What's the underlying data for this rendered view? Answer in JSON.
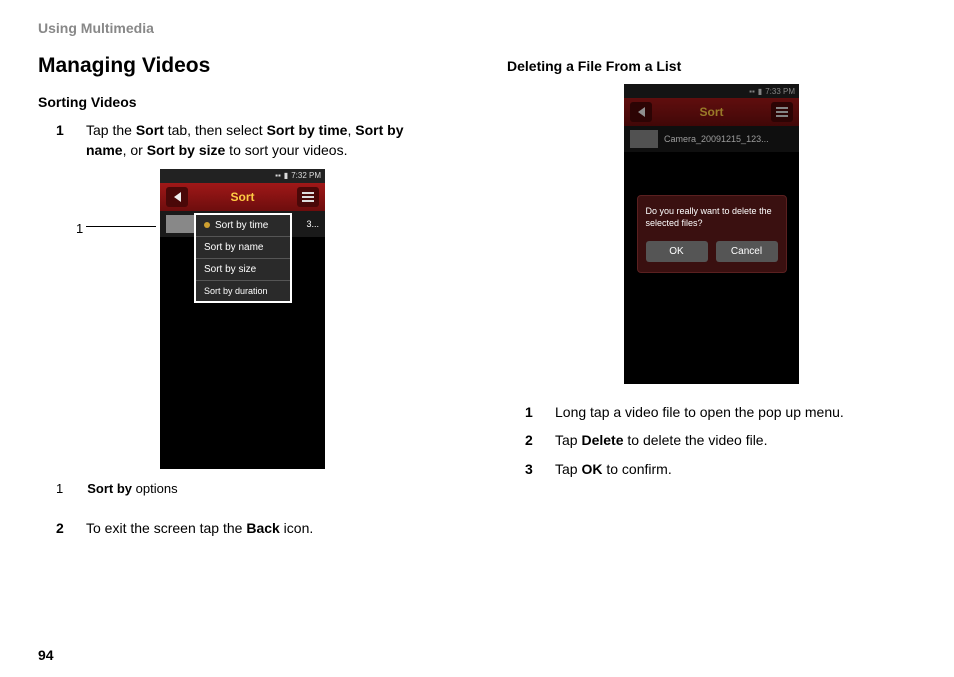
{
  "header": "Using Multimedia",
  "page_number": "94",
  "left": {
    "h1": "Managing Videos",
    "h2": "Sorting Videos",
    "steps": [
      {
        "num": "1",
        "parts": [
          "Tap the ",
          "Sort",
          " tab, then select ",
          "Sort by time",
          ", ",
          "Sort by name",
          ", or ",
          "Sort by size",
          " to sort your videos."
        ]
      },
      {
        "num": "2",
        "parts": [
          "To exit the screen tap the ",
          "Back",
          " icon."
        ]
      }
    ],
    "callout_num": "1",
    "legend_num": "1",
    "legend_bold": "Sort by",
    "legend_rest": " options",
    "phone": {
      "time": "7:32 PM",
      "tab": "Sort",
      "video_label": "3...",
      "menu": [
        "Sort by time",
        "Sort by name",
        "Sort by size",
        "Sort by duration"
      ]
    }
  },
  "right": {
    "h2": "Deleting a File From a List",
    "steps": [
      {
        "num": "1",
        "parts": [
          "Long tap a video file to open the pop up menu."
        ]
      },
      {
        "num": "2",
        "parts": [
          "Tap ",
          "Delete",
          " to delete the video file."
        ]
      },
      {
        "num": "3",
        "parts": [
          "Tap ",
          "OK",
          " to confirm."
        ]
      }
    ],
    "phone": {
      "time": "7:33 PM",
      "tab": "Sort",
      "video_label": "Camera_20091215_123...",
      "dialog_text": "Do you really want to delete the selected files?",
      "ok": "OK",
      "cancel": "Cancel"
    }
  }
}
